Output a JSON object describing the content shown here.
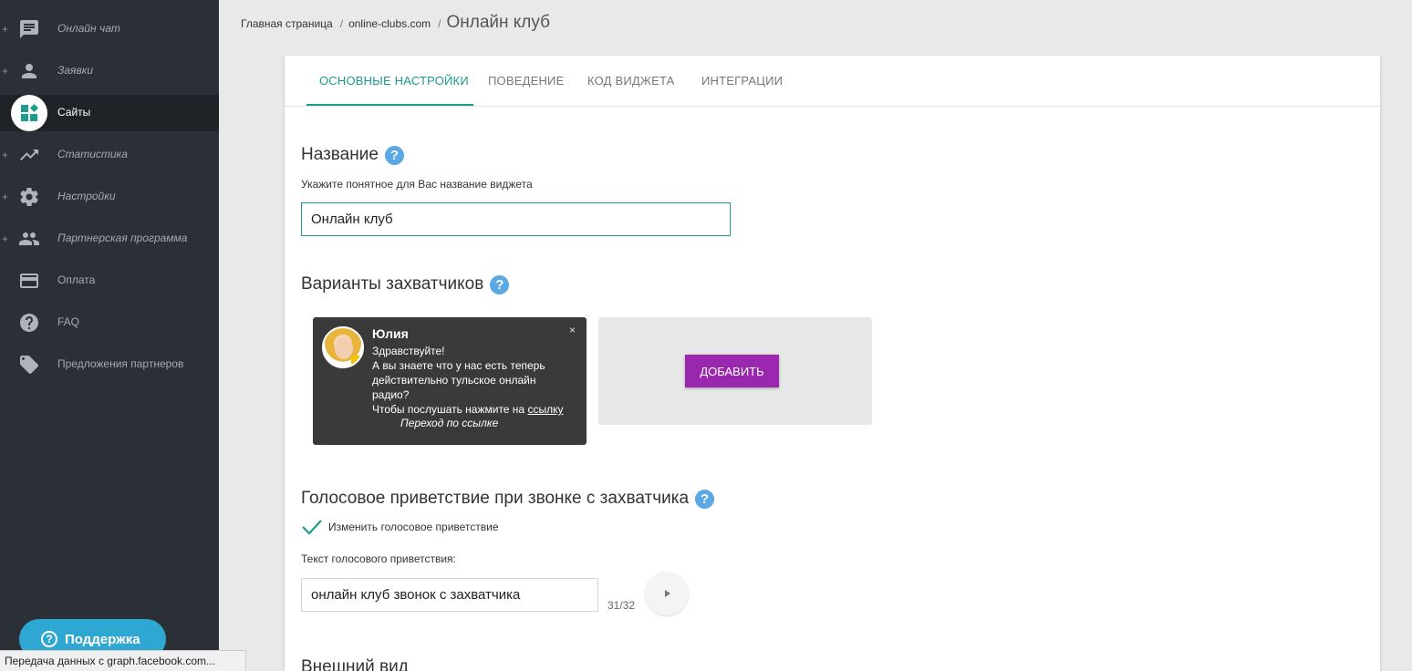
{
  "sidebar": {
    "items": [
      {
        "label": "Онлайн чат",
        "icon": "chat-icon",
        "has_plus": true
      },
      {
        "label": "Заявки",
        "icon": "person-icon",
        "has_plus": true
      },
      {
        "label": "Сайты",
        "icon": "dashboard-icon",
        "has_plus": false,
        "active": true
      },
      {
        "label": "Статистика",
        "icon": "trending-up-icon",
        "has_plus": true
      },
      {
        "label": "Настройки",
        "icon": "gear-icon",
        "has_plus": true
      },
      {
        "label": "Партнерская программа",
        "icon": "people-icon",
        "has_plus": true
      },
      {
        "label": "Оплата",
        "icon": "credit-card-icon",
        "has_plus": false
      },
      {
        "label": "FAQ",
        "icon": "help-circle-icon",
        "has_plus": false
      },
      {
        "label": "Предложения партнеров",
        "icon": "tag-icon",
        "has_plus": false
      }
    ],
    "plus_symbol": "+",
    "support_label": "Поддержка"
  },
  "statusbar": "Передача данных с graph.facebook.com...",
  "breadcrumb": {
    "home": "Главная страница",
    "site": "online-clubs.com",
    "current": "Онлайн клуб",
    "sep": "/"
  },
  "tabs": [
    {
      "label": "ОСНОВНЫЕ НАСТРОЙКИ",
      "active": true
    },
    {
      "label": "ПОВЕДЕНИЕ",
      "active": false
    },
    {
      "label": "КОД ВИДЖЕТА",
      "active": false
    },
    {
      "label": "ИНТЕГРАЦИИ",
      "active": false
    }
  ],
  "name_section": {
    "title": "Название",
    "hint": "Укажите понятное для Вас название виджета",
    "value": "Онлайн клуб"
  },
  "grabbers_section": {
    "title": "Варианты захватчиков",
    "widget": {
      "name": "Юлия",
      "close": "×",
      "line1": "Здравствуйте!",
      "line2": "А вы знаете что у нас есть теперь",
      "line3": "действительно тульское онлайн",
      "line4": "радио?",
      "line5_prefix": "Чтобы послушать нажмите на ",
      "line5_link": "ссылку",
      "goto": "Переход по ссылке"
    },
    "add_label": "ДОБАВИТЬ"
  },
  "voice_section": {
    "title": "Голосовое приветствие при звонке с захватчика",
    "checkbox_label": "Изменить голосовое приветствие",
    "checked": true,
    "text_label": "Текст голосового приветствия:",
    "value": "онлайн клуб звонок с захватчика",
    "counter": "31/32"
  },
  "appearance_section": {
    "title": "Внешний вид"
  },
  "help_symbol": "?",
  "colors": {
    "sidebar_bg": "#2b3036",
    "accent": "#1c9b8e",
    "add_button": "#9b27af",
    "help": "#5aa8e4",
    "support": "#2fa7d3"
  }
}
